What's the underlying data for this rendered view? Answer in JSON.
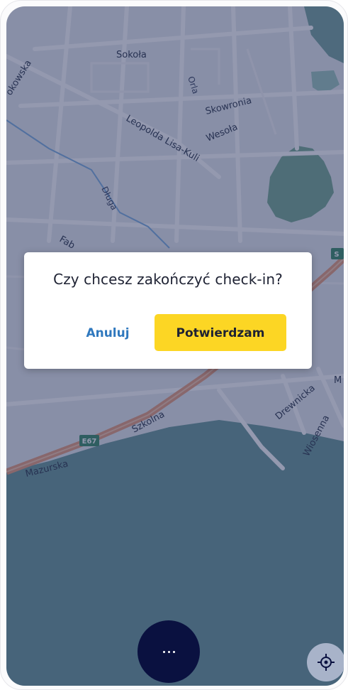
{
  "map": {
    "streets": {
      "sokola": "Sokoła",
      "orla": "Orla",
      "skowronia": "Skowronia",
      "wesola": "Wesoła",
      "leopolda": "Leopolda Lisa-Kuli",
      "dluga": "Długa",
      "sokowska": "okowska",
      "fab": "Fab",
      "szkolna": "Szkolna",
      "mazurska": "Mazurska",
      "drewnicka": "Drewnicka",
      "wiosenna": "Wiosenna",
      "m_edge": "M",
      "s_edge": "S"
    },
    "road_badge": "E67",
    "colors": {
      "background": "#e9ebef",
      "water": "#6c9a9a",
      "highway": "#e9a07f",
      "river": "#7fb0e0",
      "overlay": "rgba(32,42,88,0.48)"
    }
  },
  "dialog": {
    "title": "Czy chcesz zakończyć check-in?",
    "cancel_label": "Anuluj",
    "confirm_label": "Potwierdzam",
    "accent": "#fcd624",
    "link_color": "#2f78be"
  },
  "fab": {
    "icon": "more-horizontal-icon",
    "color": "#0a1140"
  },
  "locate": {
    "icon": "crosshair-icon"
  }
}
